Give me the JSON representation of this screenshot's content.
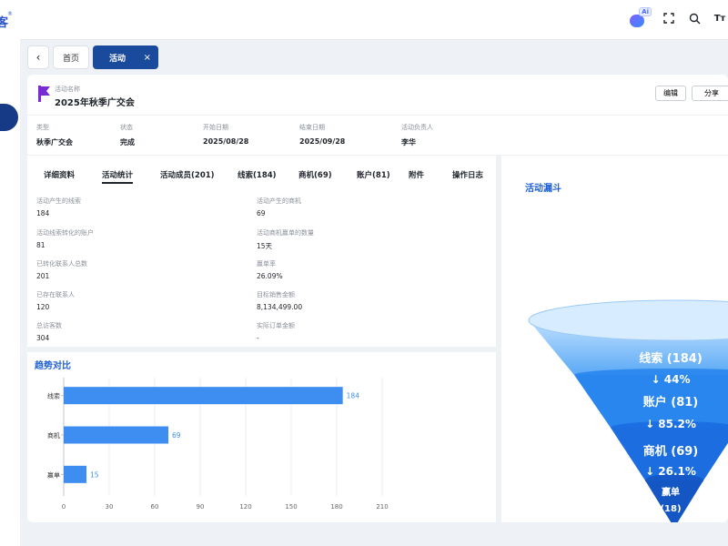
{
  "app": {
    "logo_text": "客",
    "registered": "®"
  },
  "topbar": {
    "ai_tag": "Ai",
    "font_icon_label": "Tт"
  },
  "tabs": {
    "home": "首页",
    "active": "活动",
    "close": "×",
    "back": "‹"
  },
  "activity": {
    "name_label": "活动名称",
    "name": "2025年秋季广交会",
    "edit_button": "编辑",
    "share_button": "分享",
    "meta": [
      {
        "label": "类型",
        "value": "秋季广交会"
      },
      {
        "label": "状态",
        "value": "完成"
      },
      {
        "label": "开始日期",
        "value": "2025/08/28"
      },
      {
        "label": "结束日期",
        "value": "2025/09/28"
      },
      {
        "label": "活动负责人",
        "value": "李华"
      }
    ]
  },
  "subtabs": [
    "详细资料",
    "活动统计",
    "活动成员(201)",
    "线索(184)",
    "商机(69)",
    "账户(81)",
    "附件",
    "操作日志"
  ],
  "stats": [
    {
      "label": "活动产生的线索",
      "value": "184"
    },
    {
      "label": "活动产生的商机",
      "value": "69"
    },
    {
      "label": "活动线索转化的账户",
      "value": "81"
    },
    {
      "label": "活动商机赢单的数量",
      "value": "15天"
    },
    {
      "label": "已转化联系人总数",
      "value": "201"
    },
    {
      "label": "赢单率",
      "value": "26.09%"
    },
    {
      "label": "已存在联系人",
      "value": "120"
    },
    {
      "label": "目标销售金额",
      "value": "8,134,499.00"
    },
    {
      "label": "总访客数",
      "value": "304"
    },
    {
      "label": "实际订单金额",
      "value": "-"
    }
  ],
  "trend": {
    "title": "趋势对比"
  },
  "funnel": {
    "title": "活动漏斗",
    "levels": [
      {
        "label": "线索 (184)",
        "rate": "↓ 44%"
      },
      {
        "label": "账户 (81)",
        "rate": "↓ 85.2%"
      },
      {
        "label": "商机 (69)",
        "rate": "↓ 26.1%"
      },
      {
        "label": "赢单",
        "count": "(18)"
      }
    ],
    "colors": [
      "#5aa9f5",
      "#2a86ef",
      "#1b6de0",
      "#1456c4"
    ]
  },
  "chart_data": {
    "type": "bar",
    "orientation": "horizontal",
    "title": "趋势对比",
    "categories": [
      "线索",
      "商机",
      "赢单"
    ],
    "values": [
      184,
      69,
      15
    ],
    "xlim": [
      0,
      210
    ],
    "xticks": [
      0,
      30,
      60,
      90,
      120,
      150,
      180,
      210
    ],
    "bar_color": "#3d8ef0",
    "grid": true
  }
}
